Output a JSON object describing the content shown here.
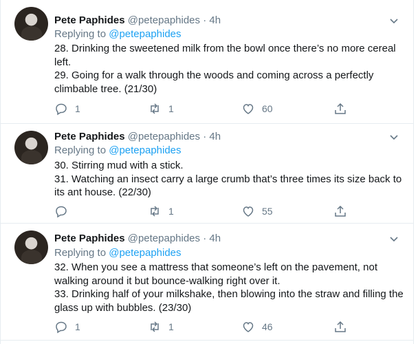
{
  "tweets": [
    {
      "name": "Pete Paphides",
      "handle": "@petepaphides",
      "dot": "·",
      "time": "4h",
      "replying_prefix": "Replying to",
      "replying_to": "@petepaphides",
      "lines": [
        "28. Drinking the sweetened milk from the bowl once there’s no more cereal left.",
        "29. Going for a walk through the woods and coming across a perfectly climbable tree. (21/30)"
      ],
      "replies": "1",
      "retweets": "1",
      "likes": "60"
    },
    {
      "name": "Pete Paphides",
      "handle": "@petepaphides",
      "dot": "·",
      "time": "4h",
      "replying_prefix": "Replying to",
      "replying_to": "@petepaphides",
      "lines": [
        "30. Stirring mud with a stick.",
        "31. Watching an insect carry a large crumb that’s three times its size back to its ant house. (22/30)"
      ],
      "replies": "",
      "retweets": "1",
      "likes": "55"
    },
    {
      "name": "Pete Paphides",
      "handle": "@petepaphides",
      "dot": "·",
      "time": "4h",
      "replying_prefix": "Replying to",
      "replying_to": "@petepaphides",
      "lines": [
        "32. When you see a mattress that someone’s left on the pavement, not walking around it but bounce-walking right over it.",
        "33. Drinking half of your milkshake, then blowing into the straw and filling the glass up with bubbles. (23/30)"
      ],
      "replies": "1",
      "retweets": "1",
      "likes": "46"
    }
  ],
  "colors": {
    "accent": "#1da1f2",
    "secondary": "#657786",
    "text": "#14171a",
    "border": "#e6ecf0"
  },
  "icons": [
    "reply-icon",
    "retweet-icon",
    "like-icon",
    "share-icon",
    "chevron-down-icon"
  ]
}
